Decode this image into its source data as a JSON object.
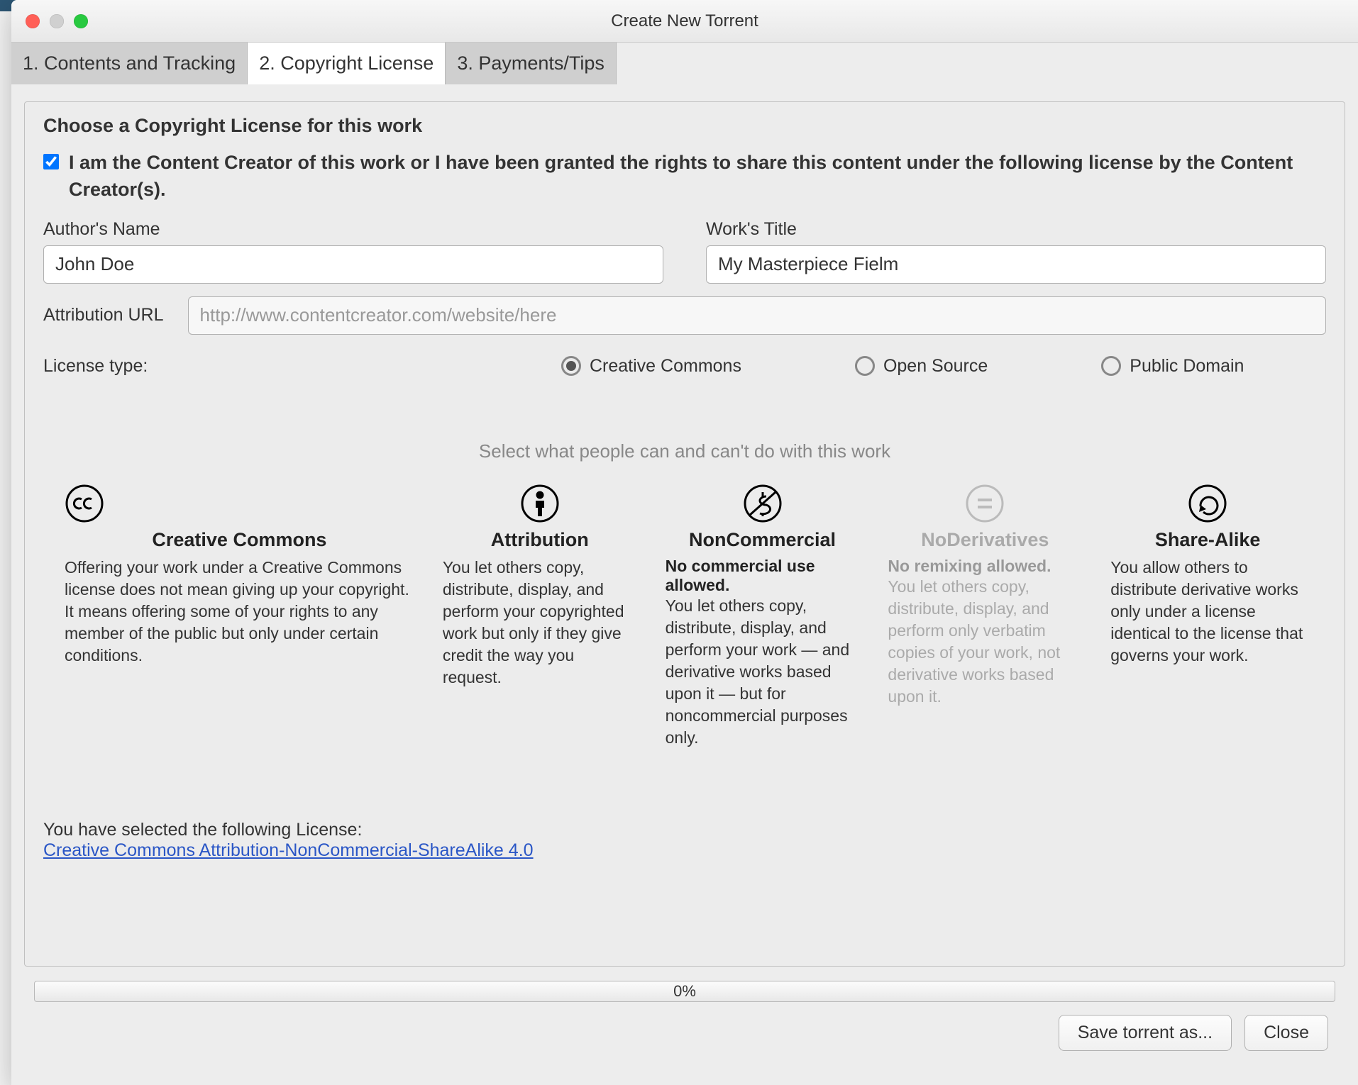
{
  "window_title": "Create New Torrent",
  "tabs": [
    {
      "label": "1. Contents and Tracking"
    },
    {
      "label": "2. Copyright License"
    },
    {
      "label": "3. Payments/Tips"
    }
  ],
  "group_legend": "Choose a Copyright License for this work",
  "creator_checkbox_label": "I am the Content Creator of this work or I have been granted the rights to share this content under the following license by the Content Creator(s).",
  "creator_checked": true,
  "author_label": "Author's Name",
  "author_value": "John Doe",
  "work_label": "Work's Title",
  "work_value": "My Masterpiece Fielm",
  "attribution_label": "Attribution URL",
  "attribution_value": "",
  "attribution_placeholder": "http://www.contentcreator.com/website/here",
  "license_type_label": "License type:",
  "license_types": {
    "creative_commons": "Creative Commons",
    "open_source": "Open Source",
    "public_domain": "Public Domain"
  },
  "subtitle": "Select what people can and can't do with this work",
  "columns": {
    "cc": {
      "title": "Creative Commons",
      "desc": "Offering your work under a Creative Commons license does not mean giving up your copyright. It means offering some of your rights to any member of the public but only under certain conditions."
    },
    "attribution": {
      "title": "Attribution",
      "desc": "You let others copy, distribute, display, and perform your copyrighted work but only if they give credit the way you request."
    },
    "noncommercial": {
      "title": "NonCommercial",
      "bold": "No commercial use allowed.",
      "desc": "You let others copy, distribute, display, and perform your work — and derivative works based upon it — but for noncommercial purposes only."
    },
    "noderivatives": {
      "title": "NoDerivatives",
      "bold": "No remixing allowed.",
      "desc": "You let others copy, distribute, display, and perform only verbatim copies of your work, not derivative works based upon it."
    },
    "sharealike": {
      "title": "Share-Alike",
      "desc": "You allow others to distribute derivative works only under a license identical to the license that governs your work."
    }
  },
  "selected_label": "You have selected the following License:",
  "selected_link_text": "Creative Commons Attribution-NonCommercial-ShareAlike 4.0",
  "progress_text": "0%",
  "save_button": "Save torrent as...",
  "close_button": "Close"
}
